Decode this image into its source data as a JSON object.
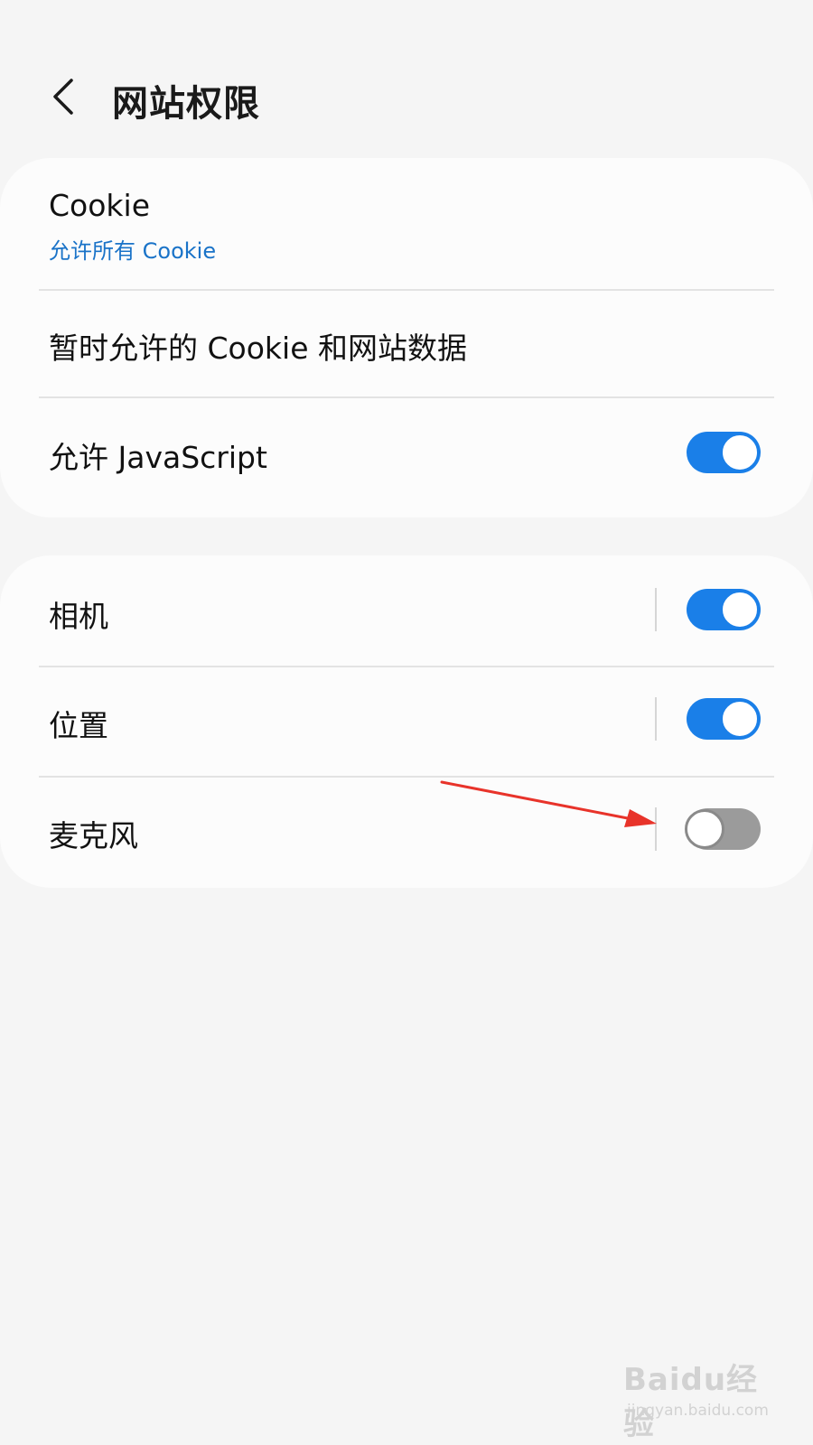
{
  "header": {
    "title": "网站权限",
    "back_icon": "chevron-left-icon"
  },
  "settings_group_1": {
    "cookie": {
      "label": "Cookie",
      "value": "允许所有 Cookie"
    },
    "temp_cookies": {
      "label": "暂时允许的 Cookie 和网站数据"
    },
    "javascript": {
      "label": "允许 JavaScript",
      "enabled": true
    }
  },
  "settings_group_2": {
    "camera": {
      "label": "相机",
      "enabled": true
    },
    "location": {
      "label": "位置",
      "enabled": true
    },
    "microphone": {
      "label": "麦克风",
      "enabled": false
    }
  },
  "colors": {
    "accent": "#1a7fe8",
    "link": "#1a73c8",
    "annotation_arrow": "#e8332a"
  },
  "watermark": {
    "logo": "Baidu经验",
    "url": "jingyan.baidu.com"
  }
}
